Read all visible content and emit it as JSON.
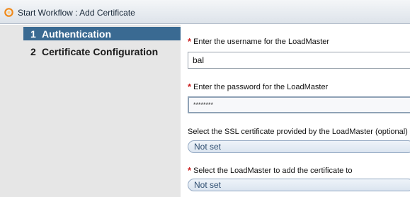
{
  "window": {
    "title": "Start Workflow : Add Certificate"
  },
  "sidebar": {
    "steps": [
      {
        "number": "1",
        "label": "Authentication"
      },
      {
        "number": "2",
        "label": "Certificate Configuration"
      }
    ]
  },
  "form": {
    "username": {
      "label": "Enter the username for the LoadMaster",
      "required_mark": "*",
      "value": "bal"
    },
    "password": {
      "label": "Enter the password for the LoadMaster",
      "required_mark": "*",
      "masked_value": "********"
    },
    "ssl_certificate": {
      "label": "Select the SSL certificate provided by the LoadMaster (optional)",
      "value": "Not set"
    },
    "loadmaster": {
      "label": "Select the LoadMaster to add the certificate to",
      "required_mark": "*",
      "value": "Not set"
    }
  },
  "colors": {
    "active_step_bg": "#3a6a92",
    "required_star": "#cc2222",
    "sidebar_bg": "#e6e6e6"
  }
}
